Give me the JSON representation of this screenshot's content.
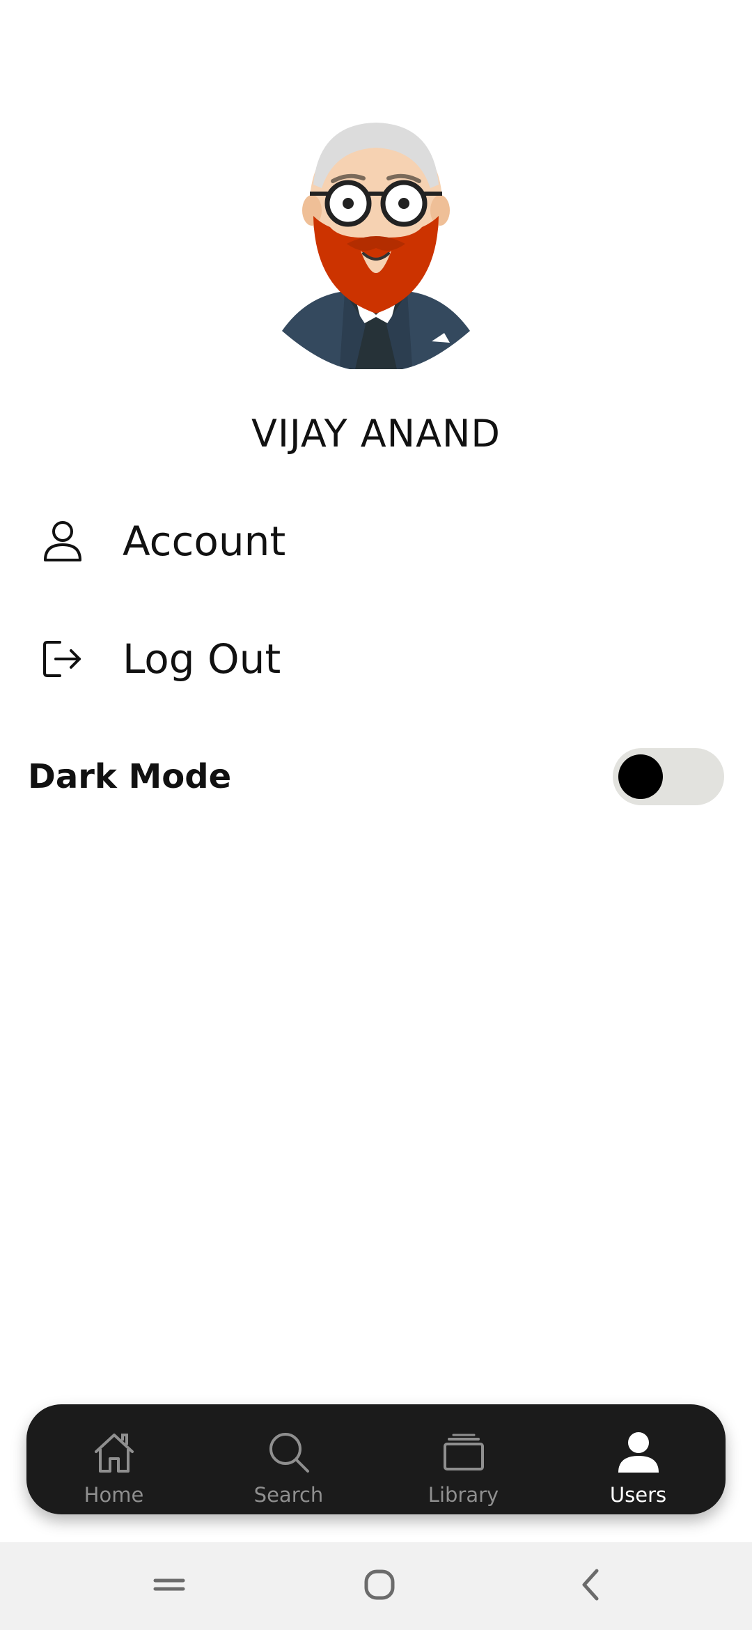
{
  "profile": {
    "name": "VIJAY ANAND",
    "avatar": "avatar-illustration"
  },
  "menu": {
    "account": {
      "label": "Account",
      "icon": "person-outline-icon"
    },
    "logout": {
      "label": "Log Out",
      "icon": "logout-icon"
    }
  },
  "settings": {
    "dark_mode_label": "Dark Mode",
    "dark_mode_enabled": false
  },
  "bottom_nav": {
    "items": [
      {
        "label": "Home",
        "icon": "home-icon",
        "active": false
      },
      {
        "label": "Search",
        "icon": "search-icon",
        "active": false
      },
      {
        "label": "Library",
        "icon": "library-icon",
        "active": false
      },
      {
        "label": "Users",
        "icon": "user-icon",
        "active": true
      }
    ]
  },
  "system_nav": {
    "buttons": [
      "recents",
      "home",
      "back"
    ]
  },
  "colors": {
    "background": "#ffffff",
    "nav_background": "#1b1b1b",
    "nav_inactive": "#8f8f8f",
    "nav_active": "#ffffff",
    "toggle_track": "#e2e2de",
    "toggle_knob": "#000000",
    "system_bar": "#f1f1f1",
    "beard": "#cc3300"
  }
}
